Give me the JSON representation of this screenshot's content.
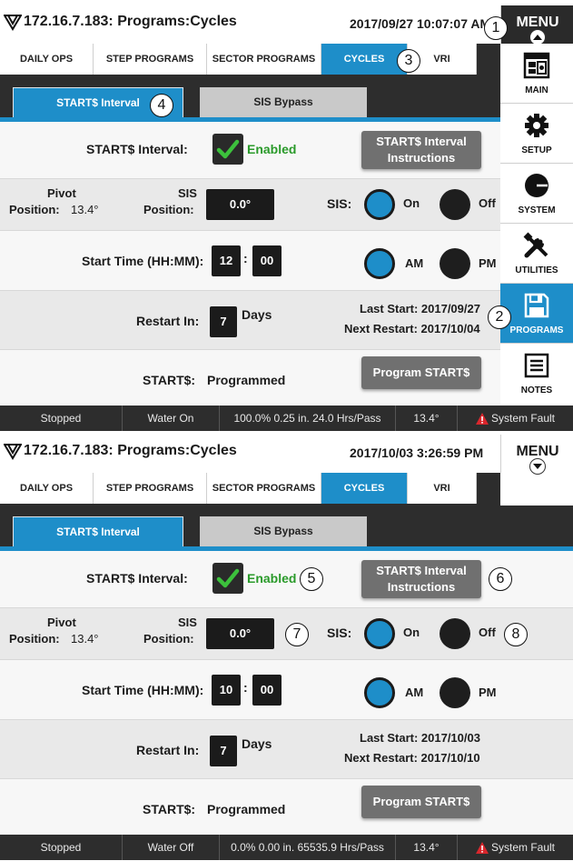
{
  "screens": [
    {
      "host_title": "172.16.7.183: Programs:Cycles",
      "datetime": "2017/09/27 10:07:07 AM",
      "menu_label": "MENU",
      "tabs": [
        "DAILY OPS",
        "STEP PROGRAMS",
        "SECTOR PROGRAMS",
        "CYCLES",
        "VRI"
      ],
      "active_tab": "CYCLES",
      "subtabs": [
        "START$ Interval",
        "SIS Bypass"
      ],
      "start_interval_label": "START$ Interval:",
      "enabled_label": "Enabled",
      "instructions_line1": "START$ Interval",
      "instructions_line2": "Instructions",
      "pivot_label_1": "Pivot",
      "pivot_label_2": "Position:",
      "pivot_value": "13.4°",
      "sis_label_1": "SIS",
      "sis_label_2": "Position:",
      "sis_value": "0.0°",
      "sis_radio_label": "SIS:",
      "on_label": "On",
      "off_label": "Off",
      "start_time_label": "Start Time (HH:MM):",
      "hour": "12",
      "colon": ":",
      "minute": "00",
      "am_label": "AM",
      "pm_label": "PM",
      "restart_label": "Restart In:",
      "restart_value": "7",
      "days_label": "Days",
      "last_start": "Last Start: 2017/09/27",
      "next_restart": "Next Restart: 2017/10/04",
      "starts_label": "START$:",
      "starts_value": "Programmed",
      "program_btn": "Program START$",
      "status": [
        "Stopped",
        "Water On",
        "100.0%  0.25 in.  24.0 Hrs/Pass",
        "13.4°",
        "System Fault"
      ],
      "sidebar": [
        "MAIN",
        "SETUP",
        "SYSTEM",
        "UTILITIES",
        "PROGRAMS",
        "NOTES"
      ],
      "callouts": [
        "1",
        "2",
        "3",
        "4"
      ]
    },
    {
      "host_title": "172.16.7.183: Programs:Cycles",
      "datetime": "2017/10/03 3:26:59 PM",
      "menu_label": "MENU",
      "tabs": [
        "DAILY OPS",
        "STEP PROGRAMS",
        "SECTOR PROGRAMS",
        "CYCLES",
        "VRI"
      ],
      "active_tab": "CYCLES",
      "subtabs": [
        "START$ Interval",
        "SIS Bypass"
      ],
      "start_interval_label": "START$ Interval:",
      "enabled_label": "Enabled",
      "instructions_line1": "START$ Interval",
      "instructions_line2": "Instructions",
      "pivot_label_1": "Pivot",
      "pivot_label_2": "Position:",
      "pivot_value": "13.4°",
      "sis_label_1": "SIS",
      "sis_label_2": "Position:",
      "sis_value": "0.0°",
      "sis_radio_label": "SIS:",
      "on_label": "On",
      "off_label": "Off",
      "start_time_label": "Start Time (HH:MM):",
      "hour": "10",
      "colon": ":",
      "minute": "00",
      "am_label": "AM",
      "pm_label": "PM",
      "restart_label": "Restart In:",
      "restart_value": "7",
      "days_label": "Days",
      "last_start": "Last Start: 2017/10/03",
      "next_restart": "Next Restart: 2017/10/10",
      "starts_label": "START$:",
      "starts_value": "Programmed",
      "program_btn": "Program START$",
      "status": [
        "Stopped",
        "Water Off",
        "0.0%  0.00 in.  65535.9 Hrs/Pass",
        "13.4°",
        "System Fault"
      ],
      "callouts": [
        "5",
        "6",
        "7",
        "8"
      ]
    }
  ],
  "colors": {
    "accent_blue": "#1e8ec9",
    "dark": "#2d2d2d",
    "check_green": "#2a9a2a",
    "fault_red": "#d9262c"
  },
  "icons": [
    "logo-icon",
    "menu-chevron-icon",
    "checkmark-icon",
    "warning-icon",
    "main-icon",
    "gear-icon",
    "system-icon",
    "tools-icon",
    "floppy-disk-icon",
    "notes-icon"
  ]
}
